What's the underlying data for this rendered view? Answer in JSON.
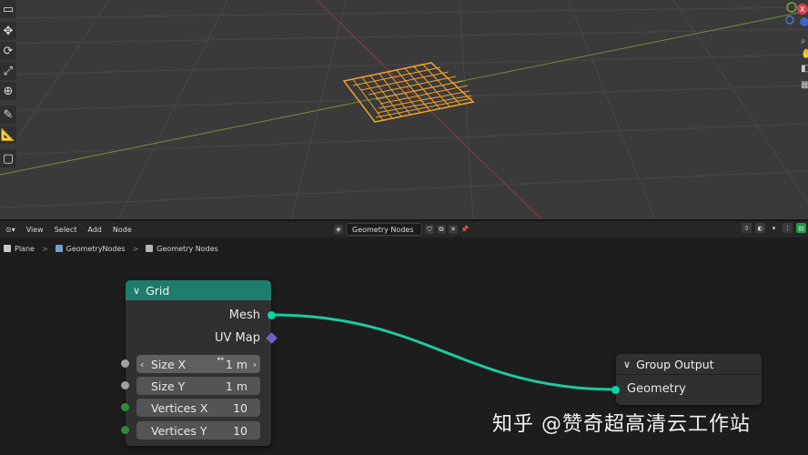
{
  "header": {
    "menus": [
      "View",
      "Select",
      "Add",
      "Node"
    ],
    "node_tree_name": "Geometry Nodes"
  },
  "breadcrumb": {
    "object": "Plane",
    "modifier": "GeometryNodes",
    "tree": "Geometry Nodes"
  },
  "grid_node": {
    "title": "Grid",
    "outputs": [
      "Mesh",
      "UV Map"
    ],
    "inputs": [
      {
        "label": "Size X",
        "value": "1 m"
      },
      {
        "label": "Size Y",
        "value": "1 m"
      },
      {
        "label": "Vertices X",
        "value": "10"
      },
      {
        "label": "Vertices Y",
        "value": "10"
      }
    ]
  },
  "group_output_node": {
    "title": "Group Output",
    "input": "Geometry"
  },
  "watermark": "知乎 @赞奇超高清云工作站",
  "colors": {
    "viewport_bg": "#3a3a3a",
    "editor_bg": "#1d1d1d",
    "grid_header": "#1e7c6c",
    "geometry_socket": "#00d6a3",
    "vector_socket": "#6b62c6",
    "value_socket": "#a1a1a1",
    "int_socket": "#2f8a3a",
    "selected_mesh": "#f2a12b"
  }
}
